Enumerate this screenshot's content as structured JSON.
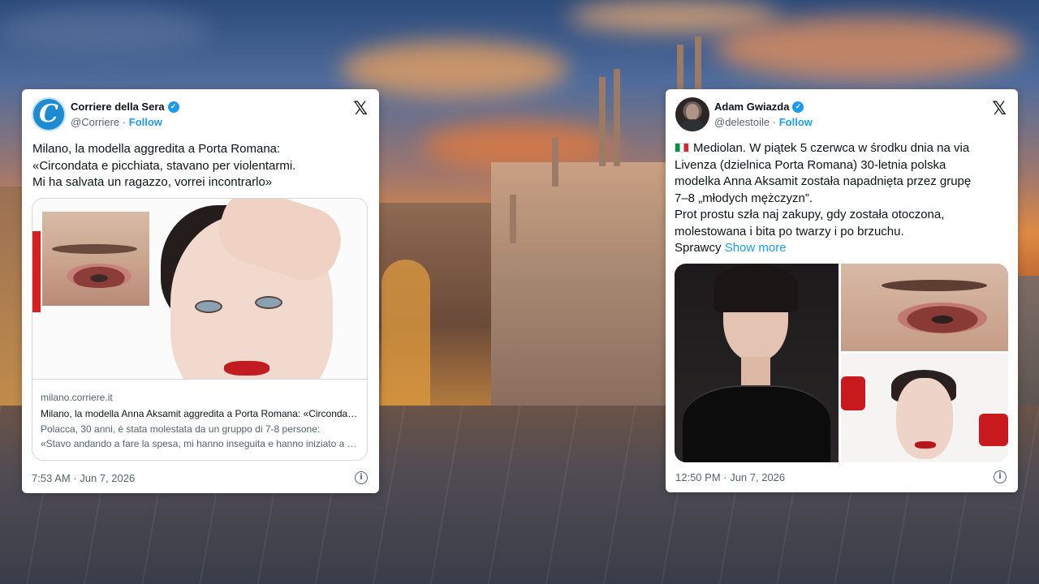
{
  "tweets": {
    "left": {
      "author_name": "Corriere della Sera",
      "handle": "@Corriere",
      "follow_label": "Follow",
      "separator": "·",
      "verified": true,
      "avatar_icon": "corriere-c-logo",
      "avatar_letter": "C",
      "platform_logo": "𝕏",
      "text_lines": [
        "Milano, la modella aggredita a Porta Romana:",
        "«Circondata e picchiata, stavano per violentarmi.",
        "Mi ha salvata un ragazzo, vorrei incontrarlo»"
      ],
      "card": {
        "domain": "milano.corriere.it",
        "title": "Milano, la modella Anna Aksamit aggredita a Porta Romana: «Circondata e picchiata, stavano per violentarmi»",
        "description_lines": [
          "Polacca, 30 anni, è stata molestata da un gruppo di 7-8 persone:",
          "«Stavo andando a fare la spesa, mi hanno inseguita e hanno iniziato a picchiarmi»"
        ]
      },
      "timestamp": "7:53 AM · Jun 7, 2026",
      "info_icon": "i"
    },
    "right": {
      "author_name": "Adam Gwiazda",
      "handle": "@delestoile",
      "follow_label": "Follow",
      "separator": "·",
      "verified": true,
      "platform_logo": "𝕏",
      "text_lines": [
        "Mediolan. W piątek 5 czerwca w środku dnia na via",
        "Livenza (dzielnica Porta Romana) 30-letnia polska",
        "modelka Anna Aksamit została napadnięta przez grupę",
        "7–8 „młodych mężczyzn”.",
        "Prot prostu szła naj zakupy, gdy została otoczona,",
        "molestowana i bita po twarzy i po brzuchu.",
        "Sprawcy"
      ],
      "show_more_label": "Show more",
      "timestamp": "12:50 PM · Jun 7, 2026",
      "info_icon": "i"
    }
  },
  "colors": {
    "link_blue": "#1d9bf0",
    "text_primary": "#0f1419",
    "text_secondary": "#536471",
    "corriere_blue": "#1d8ad1",
    "lipstick_red": "#c21c22"
  }
}
